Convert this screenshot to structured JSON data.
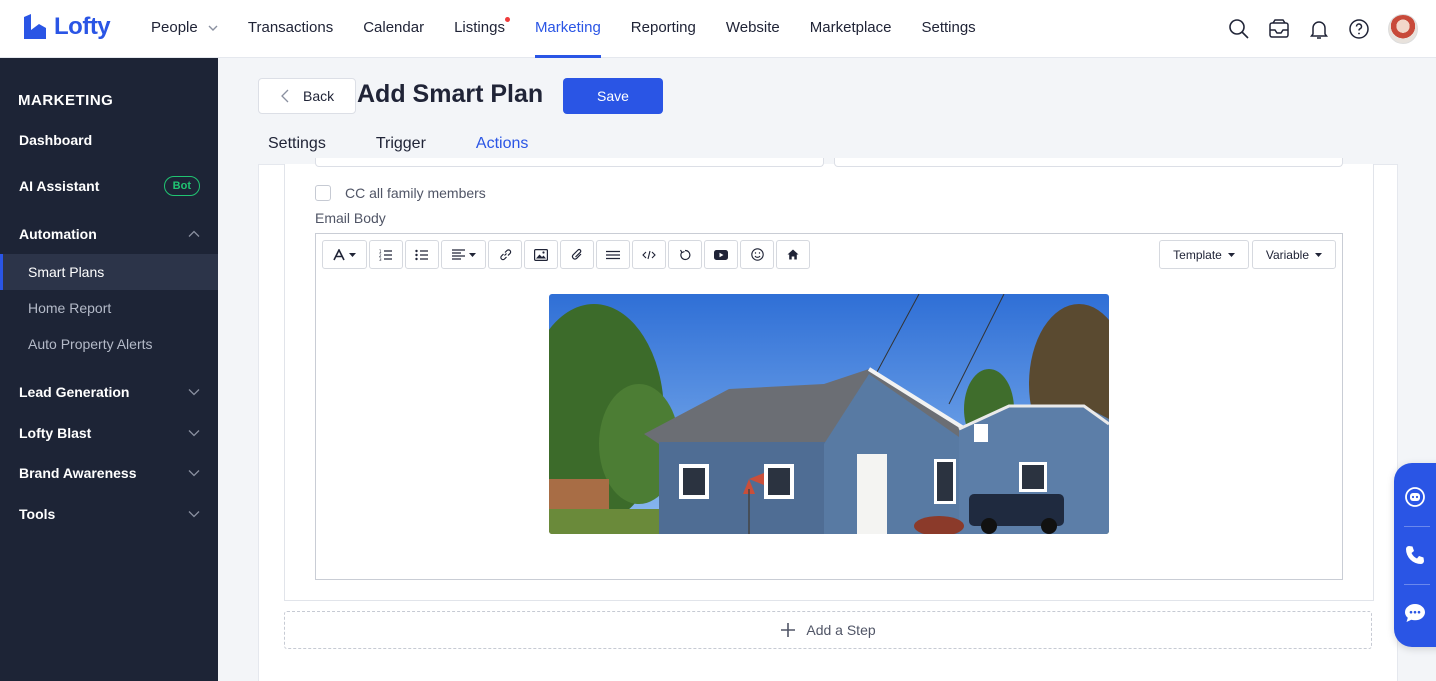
{
  "brand": {
    "name": "Lofty",
    "color": "#2a55e5"
  },
  "nav": {
    "items": [
      {
        "label": "People",
        "has_dropdown": true
      },
      {
        "label": "Transactions"
      },
      {
        "label": "Calendar"
      },
      {
        "label": "Listings",
        "has_dot": true
      },
      {
        "label": "Marketing",
        "active": true
      },
      {
        "label": "Reporting"
      },
      {
        "label": "Website"
      },
      {
        "label": "Marketplace"
      },
      {
        "label": "Settings"
      }
    ],
    "icons": [
      "search-icon",
      "inbox-icon",
      "bell-icon",
      "help-icon",
      "avatar"
    ]
  },
  "sidebar": {
    "title": "MARKETING",
    "dashboard": "Dashboard",
    "ai_assistant": "AI Assistant",
    "ai_badge": "Bot",
    "automation": "Automation",
    "automation_items": [
      "Smart Plans",
      "Home Report",
      "Auto Property Alerts"
    ],
    "lead_generation": "Lead Generation",
    "lofty_blast": "Lofty Blast",
    "brand_awareness": "Brand Awareness",
    "tools": "Tools"
  },
  "header": {
    "back_label": "Back",
    "title": "Add Smart Plan",
    "save_label": "Save"
  },
  "tabs": [
    "Settings",
    "Trigger",
    "Actions"
  ],
  "form": {
    "cc_label": "CC all family members",
    "cc_checked": false,
    "email_body_label": "Email Body"
  },
  "editor": {
    "toolbar": [
      "font-icon",
      "ordered-list-icon",
      "bullet-list-icon",
      "align-icon",
      "link-icon",
      "image-icon",
      "attachment-icon",
      "divider-icon",
      "code-icon",
      "undo-icon",
      "video-icon",
      "emoji-icon",
      "home-icon"
    ],
    "template_label": "Template",
    "variable_label": "Variable"
  },
  "add_step_label": "Add a Step",
  "float_actions": [
    "chat-bot-icon",
    "phone-icon",
    "message-icon"
  ]
}
